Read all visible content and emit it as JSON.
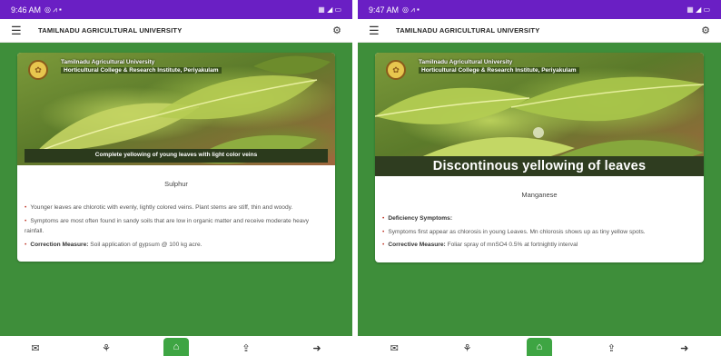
{
  "screens": [
    {
      "status": {
        "time": "9:46 AM"
      },
      "app_title": "TAMILNADU AGRICULTURAL UNIVERSITY",
      "header_line1": "Tamilnadu Agricultural University",
      "header_line2": "Horticultural College & Research Institute, Periyakulam",
      "caption": "Complete yellowing of young leaves with light color veins",
      "nutrient": "Sulphur",
      "paragraphs": [
        {
          "label": "",
          "text": "Younger leaves are chlorotic with evenly, lightly colored veins. Plant stems are stiff, thin and woody."
        },
        {
          "label": "",
          "text": "Symptoms are most often found in sandy soils that are low in organic matter and receive moderate heavy rainfall."
        },
        {
          "label": "Correction Measure:",
          "text": "Soil application of gypsum @ 100 kg acre."
        }
      ]
    },
    {
      "status": {
        "time": "9:47 AM"
      },
      "app_title": "TAMILNADU AGRICULTURAL UNIVERSITY",
      "header_line1": "Tamilnadu Agricultural University",
      "header_line2": "Horticultural College & Research Institute, Periyakulam",
      "caption": "Discontinous yellowing of leaves",
      "nutrient": "Manganese",
      "paragraphs": [
        {
          "label": "Deficiency Symptoms:",
          "text": ""
        },
        {
          "label": "",
          "text": "Symptoms first appear as chlorosis in young Leaves. Mn chlorosis shows up as tiny yellow spots."
        },
        {
          "label": "Corrective Measure:",
          "text": "Foliar spray of mnSO4 0.5% at fortnightly interval"
        }
      ]
    }
  ],
  "icons": {
    "menu": "hamburger-menu-icon",
    "settings": "gear-icon",
    "nav": [
      "mail-icon",
      "plant-icon",
      "home-icon",
      "upload-icon",
      "logout-icon"
    ]
  },
  "colors": {
    "status_bar": "#6a1fc4",
    "background_green": "#3e8e3a",
    "home_button": "#3ea543"
  }
}
